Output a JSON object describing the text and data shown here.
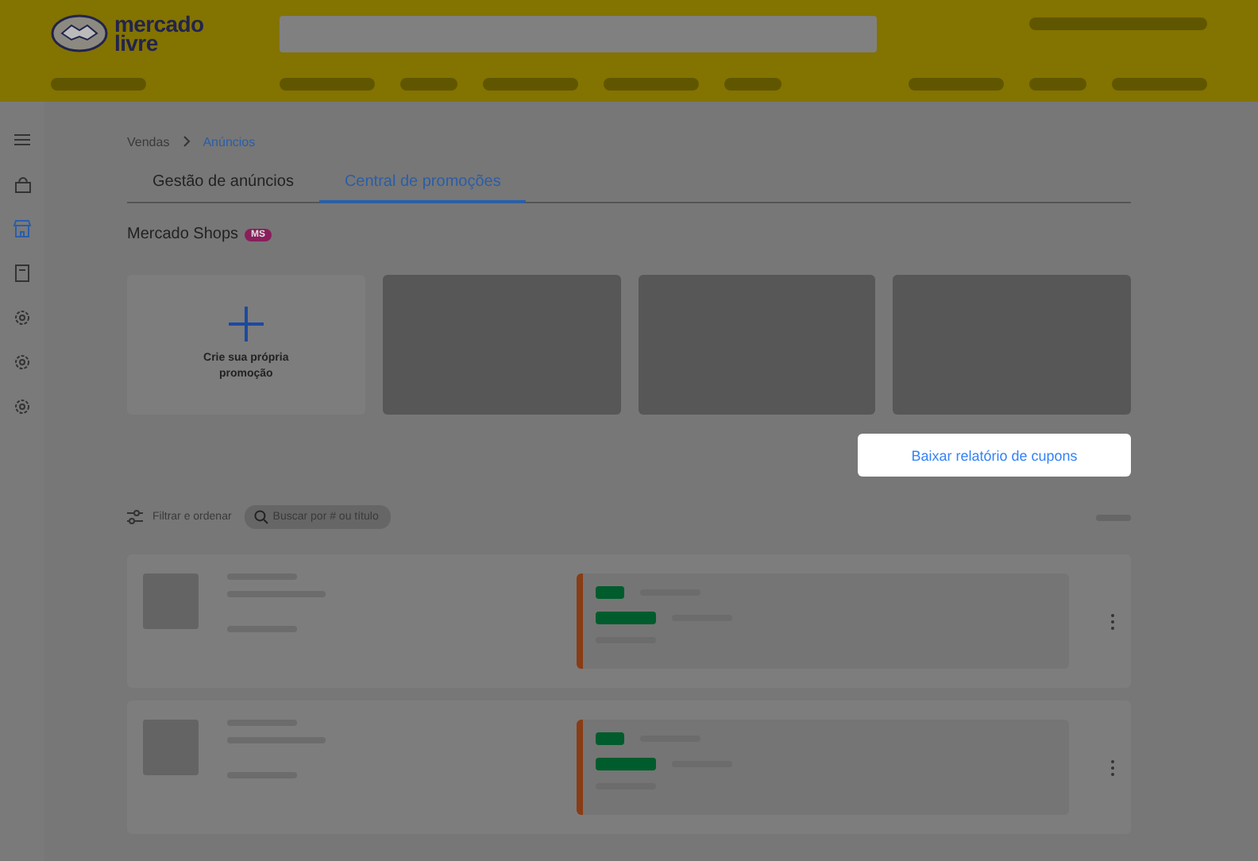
{
  "header": {
    "logo_lines": [
      "mercado",
      "livre"
    ]
  },
  "sidebar": {
    "items": [
      {
        "selected": false
      },
      {
        "selected": false
      },
      {
        "selected": true
      },
      {
        "selected": false
      },
      {
        "selected": false
      },
      {
        "selected": false
      },
      {
        "selected": false
      }
    ]
  },
  "breadcrumb": [
    "Vendas",
    "Anúncios"
  ],
  "tabs": [
    {
      "label": "Gestão de anúncios",
      "selected": false
    },
    {
      "label": "Central de promoções",
      "selected": true
    }
  ],
  "shop": {
    "name": "Mercado Shops",
    "badge": "MS"
  },
  "create_card": {
    "label": "Crie sua própria promoção"
  },
  "download_button": {
    "label": "Baixar relatório de cupons"
  },
  "filter": {
    "label": "Filtrar e ordenar"
  },
  "search": {
    "placeholder": "Buscar por # ou título"
  }
}
